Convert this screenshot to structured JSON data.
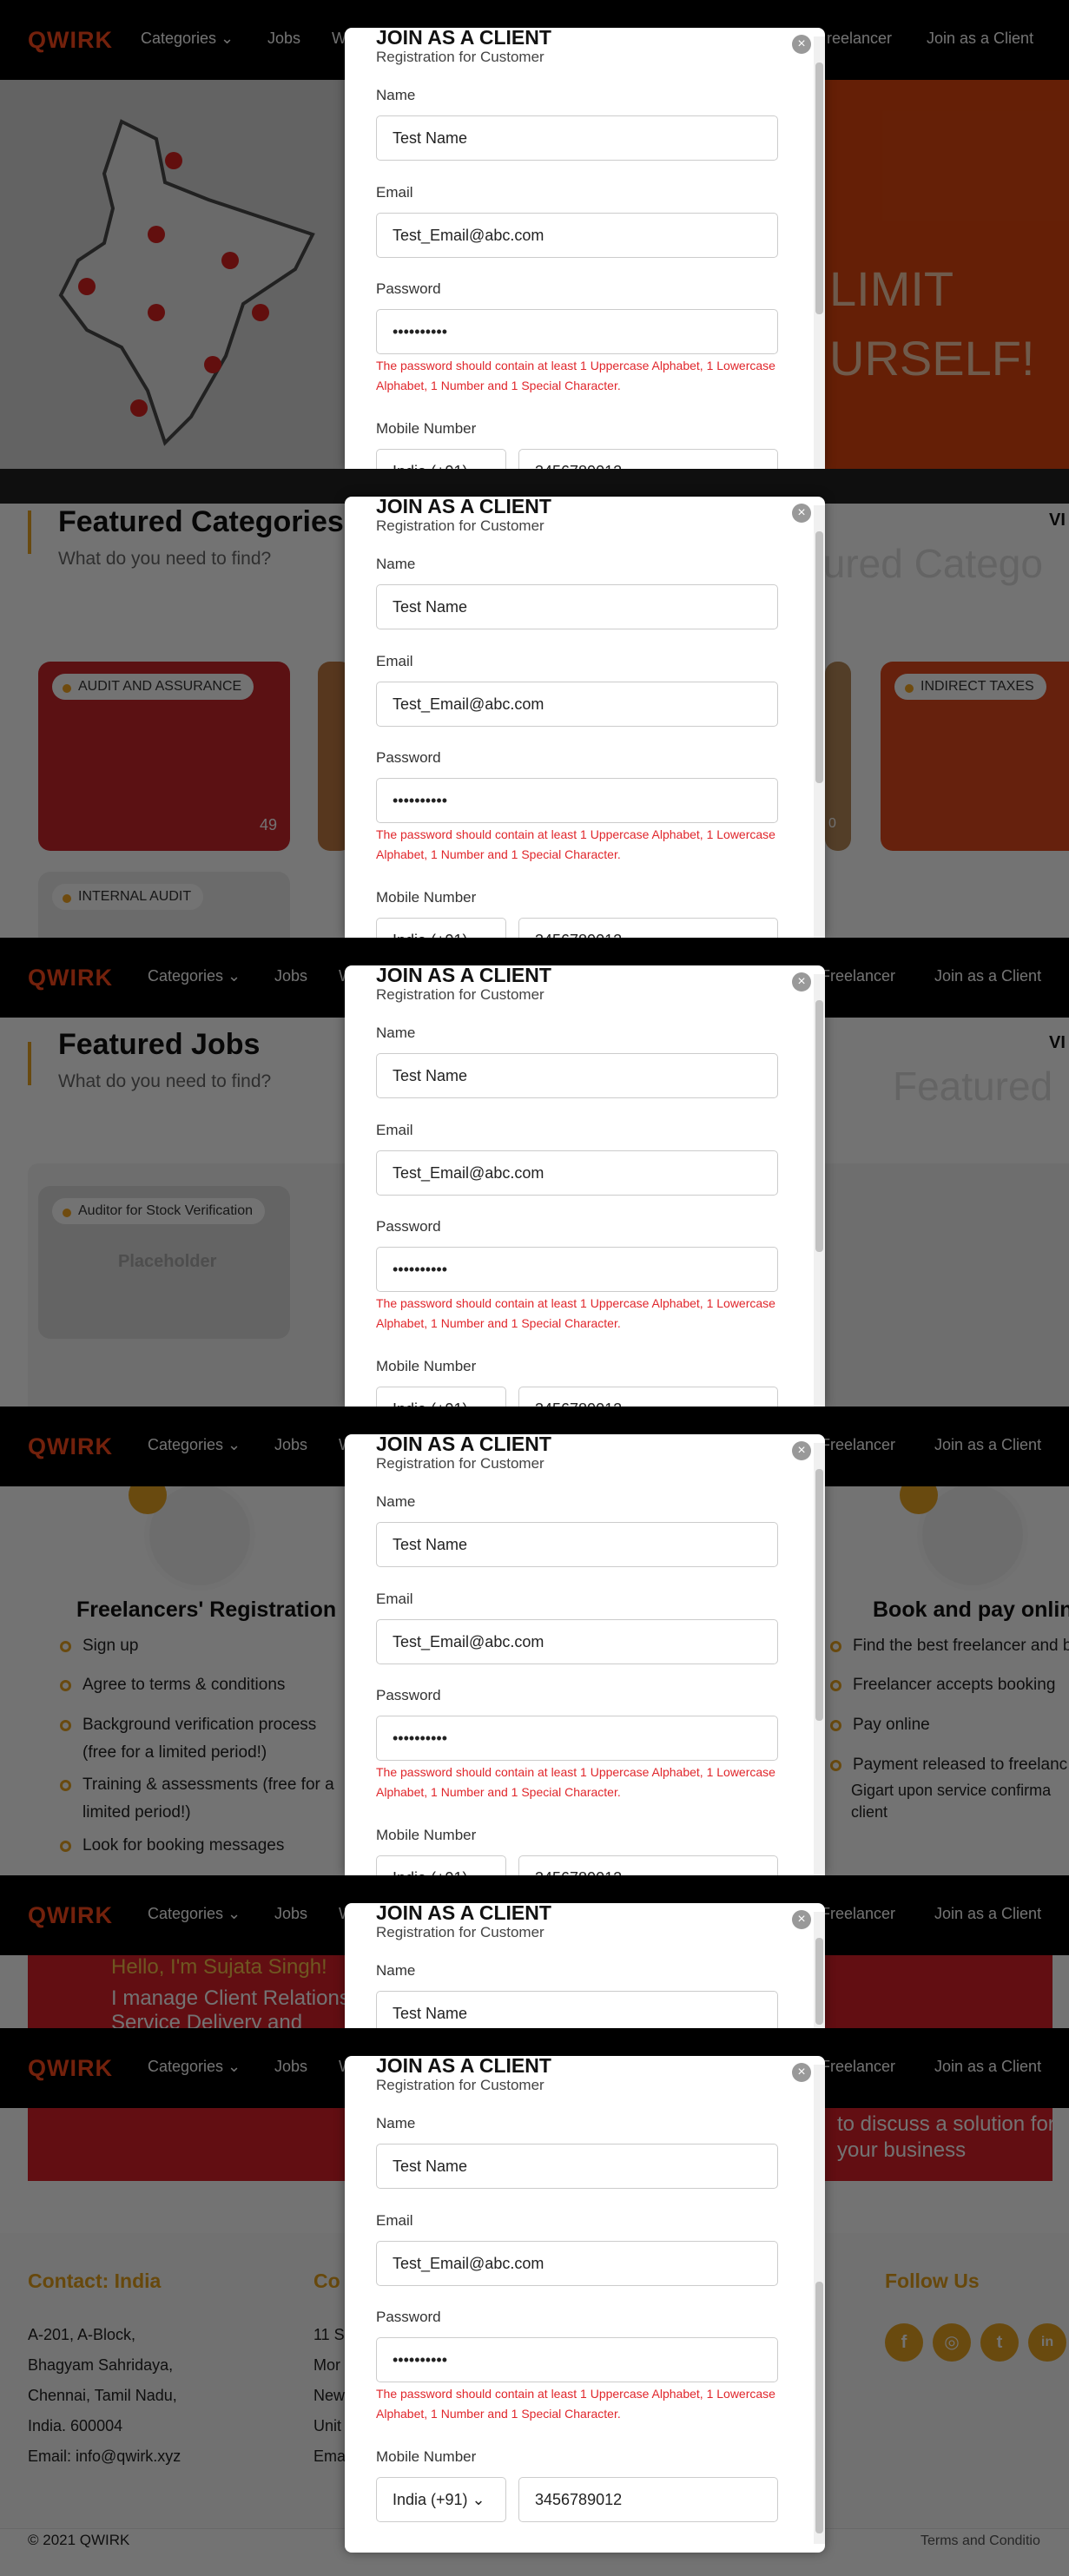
{
  "nav": {
    "logo": "QWIRK",
    "categories": "Categories ⌄",
    "jobs": "Jobs",
    "w": "W",
    "freelancer": "Freelancer",
    "freelancer_cut": "reelancer",
    "join_client": "Join as a Client"
  },
  "modal": {
    "title": "JOIN AS A CLIENT",
    "subtitle": "Registration for Customer",
    "close": "×",
    "name_label": "Name",
    "name_value": "Test Name",
    "email_label": "Email",
    "email_value": "Test_Email@abc.com",
    "password_label": "Password",
    "password_value": "••••••••••",
    "password_error": "The password should contain at least 1 Uppercase Alphabet, 1 Lowercase Alphabet, 1 Number and 1 Special Character.",
    "mobile_label": "Mobile Number",
    "country_code": "India (+91) ⌄",
    "mobile_value": "3456789012"
  },
  "hero": {
    "line1": "LIMIT",
    "line2": "URSELF!"
  },
  "categories_section": {
    "title": "Featured Categories",
    "subtitle": "What do you need to find?",
    "ghost": "tured Catego",
    "vi": "VI",
    "cards": [
      {
        "label": "AUDIT AND ASSURANCE",
        "count": "49"
      },
      {
        "label": "INDIRECT TAXES"
      },
      {
        "label": "INTERNAL AUDIT"
      }
    ],
    "partial_count": "0"
  },
  "jobs_section": {
    "title": "Featured Jobs",
    "subtitle": "What do you need to find?",
    "ghost": "Featured",
    "vi": "VI",
    "job_label": "Auditor for Stock Verification",
    "placeholder": "Placeholder"
  },
  "how_section": {
    "left_title": "Freelancers' Registration",
    "left_items": [
      "Sign up",
      "Agree to terms & conditions",
      "Background verification process (free for a limited period!)",
      "Training & assessments (free for a limited period!)",
      "Look for booking messages"
    ],
    "right_title": "Book and pay online",
    "right_items": [
      "Find the best freelancer and b",
      "Freelancer accepts booking",
      "Pay online",
      "Payment released to freelanc"
    ],
    "right_note": "Gigart upon service confirma client"
  },
  "banner": {
    "hello": "Hello, I'm Sujata Singh!",
    "manage": "I manage Client Relations Service Delivery and",
    "right": "to discuss a solution for your business"
  },
  "footer": {
    "contact_title": "Contact: India",
    "address": [
      "A-201, A-Block,",
      "Bhagyam Sahridaya,",
      "Chennai, Tamil Nadu,",
      "India. 600004",
      "Email: info@qwirk.xyz"
    ],
    "col2_title": "Co",
    "col2": [
      "11 Se",
      "Mor",
      "New",
      "Unit",
      "Ema"
    ],
    "follow": "Follow Us",
    "social": [
      "f",
      "◎",
      "t",
      "in"
    ],
    "copyright": "© 2021 QWIRK",
    "terms": "Terms and Conditio"
  },
  "colors": {
    "accent": "#ff4a1c",
    "gold": "#e8a422",
    "error": "#e0262b"
  }
}
